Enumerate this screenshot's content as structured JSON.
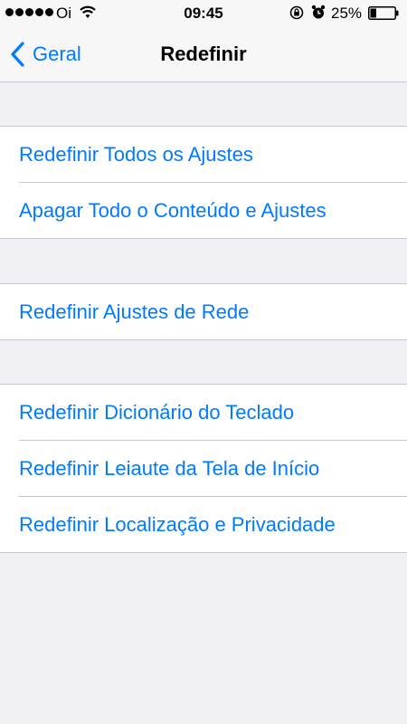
{
  "status_bar": {
    "carrier": "Oi",
    "time": "09:45",
    "battery_percent": "25%",
    "battery_level": 0.25,
    "icons": [
      "signal-dots",
      "wifi-icon",
      "rotation-lock-icon",
      "alarm-icon",
      "battery-icon"
    ]
  },
  "nav": {
    "back_label": "Geral",
    "title": "Redefinir"
  },
  "groups": [
    {
      "items": [
        {
          "label": "Redefinir Todos os Ajustes"
        },
        {
          "label": "Apagar Todo o Conteúdo e Ajustes"
        }
      ]
    },
    {
      "items": [
        {
          "label": "Redefinir Ajustes de Rede"
        }
      ]
    },
    {
      "items": [
        {
          "label": "Redefinir Dicionário do Teclado"
        },
        {
          "label": "Redefinir Leiaute da Tela de Início"
        },
        {
          "label": "Redefinir Localização e Privacidade"
        }
      ]
    }
  ],
  "colors": {
    "accent": "#007aff",
    "background": "#efeff4",
    "separator": "#c8c7cc"
  }
}
